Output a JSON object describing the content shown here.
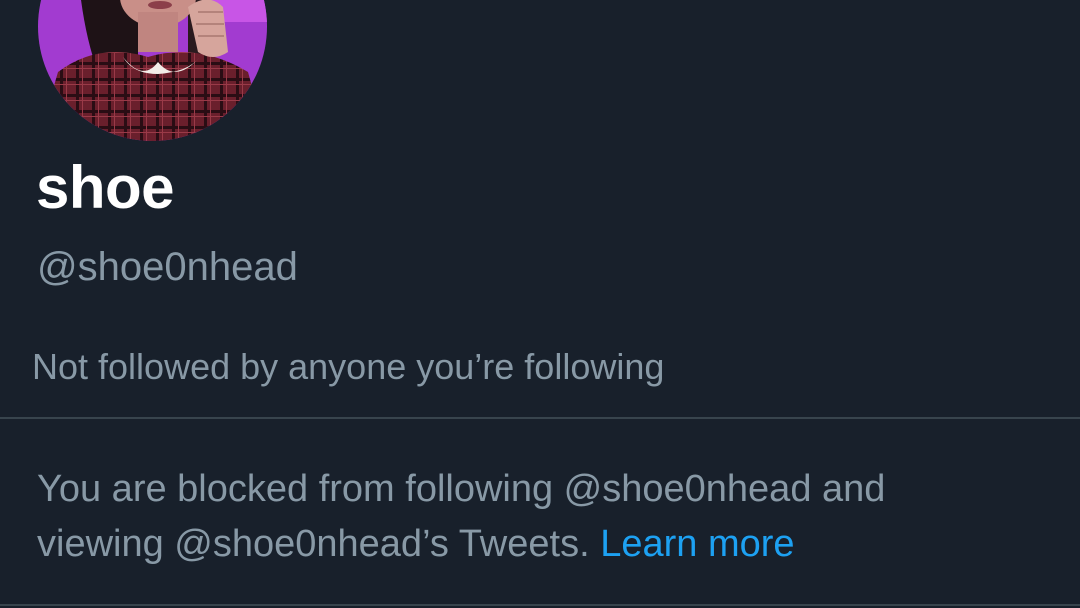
{
  "profile": {
    "display_name": "shoe",
    "handle": "@shoe0nhead",
    "followed_by_text": "Not followed by anyone you’re following",
    "avatar_icon": "profile-photo"
  },
  "blocked_notice": {
    "line1": "You are blocked from following @shoe0nhead and",
    "line2_prefix": "viewing @shoe0nhead’s Tweets. ",
    "learn_more_label": "Learn more"
  },
  "colors": {
    "background": "#18202b",
    "primary_text": "#ffffff",
    "secondary_text": "#8899a6",
    "link": "#1da1f2",
    "divider": "#38444d"
  }
}
